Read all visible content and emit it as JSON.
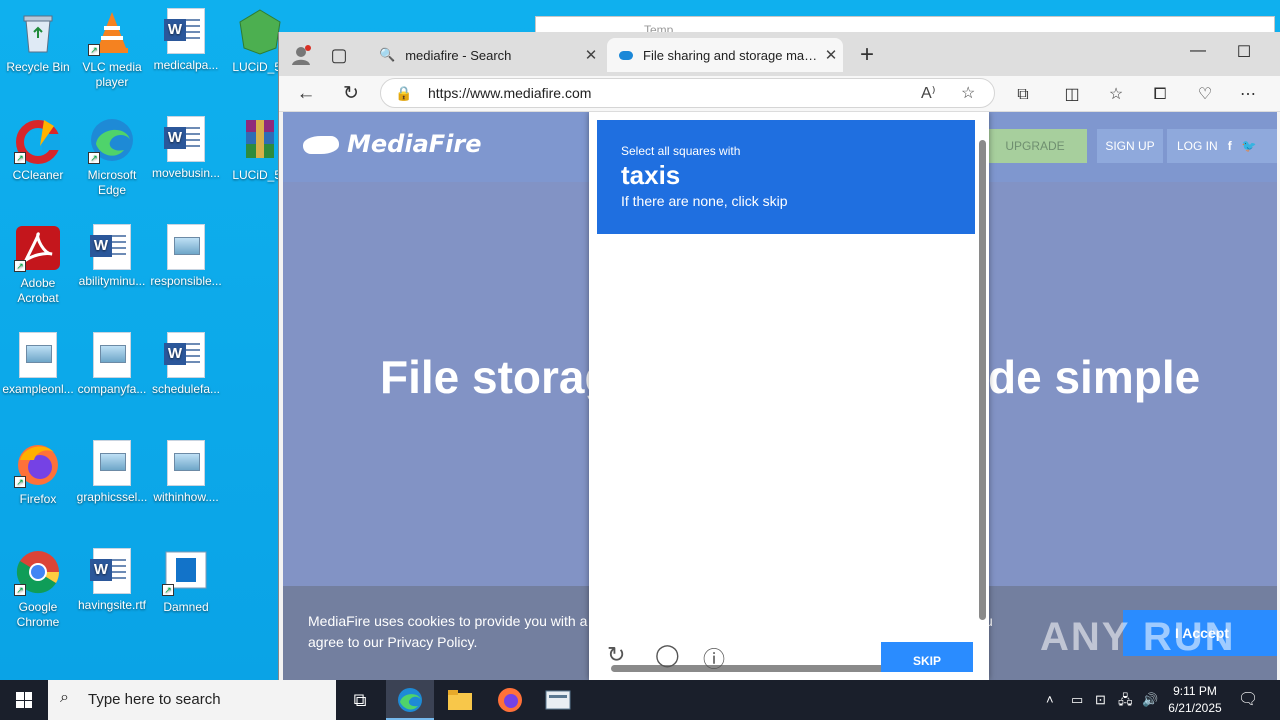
{
  "desktop": {
    "icons": [
      {
        "label": "Recycle Bin"
      },
      {
        "label": "VLC media player"
      },
      {
        "label": "medicalpa..."
      },
      {
        "label": "LUCiD_5e"
      },
      {
        "label": "CCleaner"
      },
      {
        "label": "Microsoft Edge"
      },
      {
        "label": "movebusin..."
      },
      {
        "label": "LUCiD_5e"
      },
      {
        "label": "Adobe Acrobat"
      },
      {
        "label": "abilityminu..."
      },
      {
        "label": "responsible..."
      },
      {
        "label": "exampleonl..."
      },
      {
        "label": "companyfa..."
      },
      {
        "label": "schedulefa..."
      },
      {
        "label": "Firefox"
      },
      {
        "label": "graphicssel..."
      },
      {
        "label": "withinhow...."
      },
      {
        "label": "Google Chrome"
      },
      {
        "label": "havingsite.rtf"
      },
      {
        "label": "Damned"
      }
    ],
    "bg_window_title": "Temp"
  },
  "browser": {
    "tabs": [
      {
        "title": "mediafire - Search",
        "active": false
      },
      {
        "title": "File sharing and storage made simple",
        "active": true
      }
    ],
    "url": "https://www.mediafire.com",
    "new_tab": "+"
  },
  "page": {
    "logo": "MediaFire",
    "upgrade": "UPGRADE",
    "signup": "SIGN UP",
    "login": "LOG IN",
    "hero_left": "File storag",
    "hero_right": "de simple",
    "cookie_text": "MediaFire uses cookies to provide you with a p",
    "cookie_text_line2": "agree to our Privacy Policy.",
    "cookie_text_tail": "u",
    "accept": "I Accept"
  },
  "captcha": {
    "instruction": "Select all squares with",
    "target": "taxis",
    "hint": "If there are none, click skip",
    "skip": "SKIP"
  },
  "taskbar": {
    "search_placeholder": "Type here to search",
    "time": "9:11 PM",
    "date": "6/21/2025"
  },
  "watermark": "ANY RUN",
  "colors": {
    "desktop": "#0fb0ee",
    "captcha_header": "#1f6fe0",
    "accept": "#2a8cff",
    "taxi_yellow": "#f2c230"
  }
}
